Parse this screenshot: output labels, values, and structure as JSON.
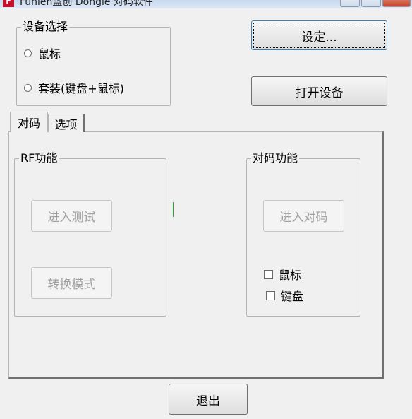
{
  "window": {
    "title": "Funlen蓝创 Dongle 对码软件",
    "icon": "app-logo-icon"
  },
  "device_select": {
    "title": "设备选择",
    "options": [
      "鼠标",
      "套装(键盘+鼠标)"
    ]
  },
  "buttons": {
    "settings": "设定...",
    "open_device": "打开设备",
    "exit": "退出"
  },
  "tabs": [
    "对码",
    "选项"
  ],
  "rf_group": {
    "title": "RF功能",
    "enter_test": "进入测试",
    "switch_mode": "转换模式"
  },
  "pair_group": {
    "title": "对码功能",
    "enter_pair": "进入对码",
    "checkboxes": [
      "鼠标",
      "键盘"
    ]
  },
  "colors": {
    "background": "#f0f0f0",
    "disabled_text": "#a0a0a0",
    "status_mark": "#2f9a2f"
  }
}
